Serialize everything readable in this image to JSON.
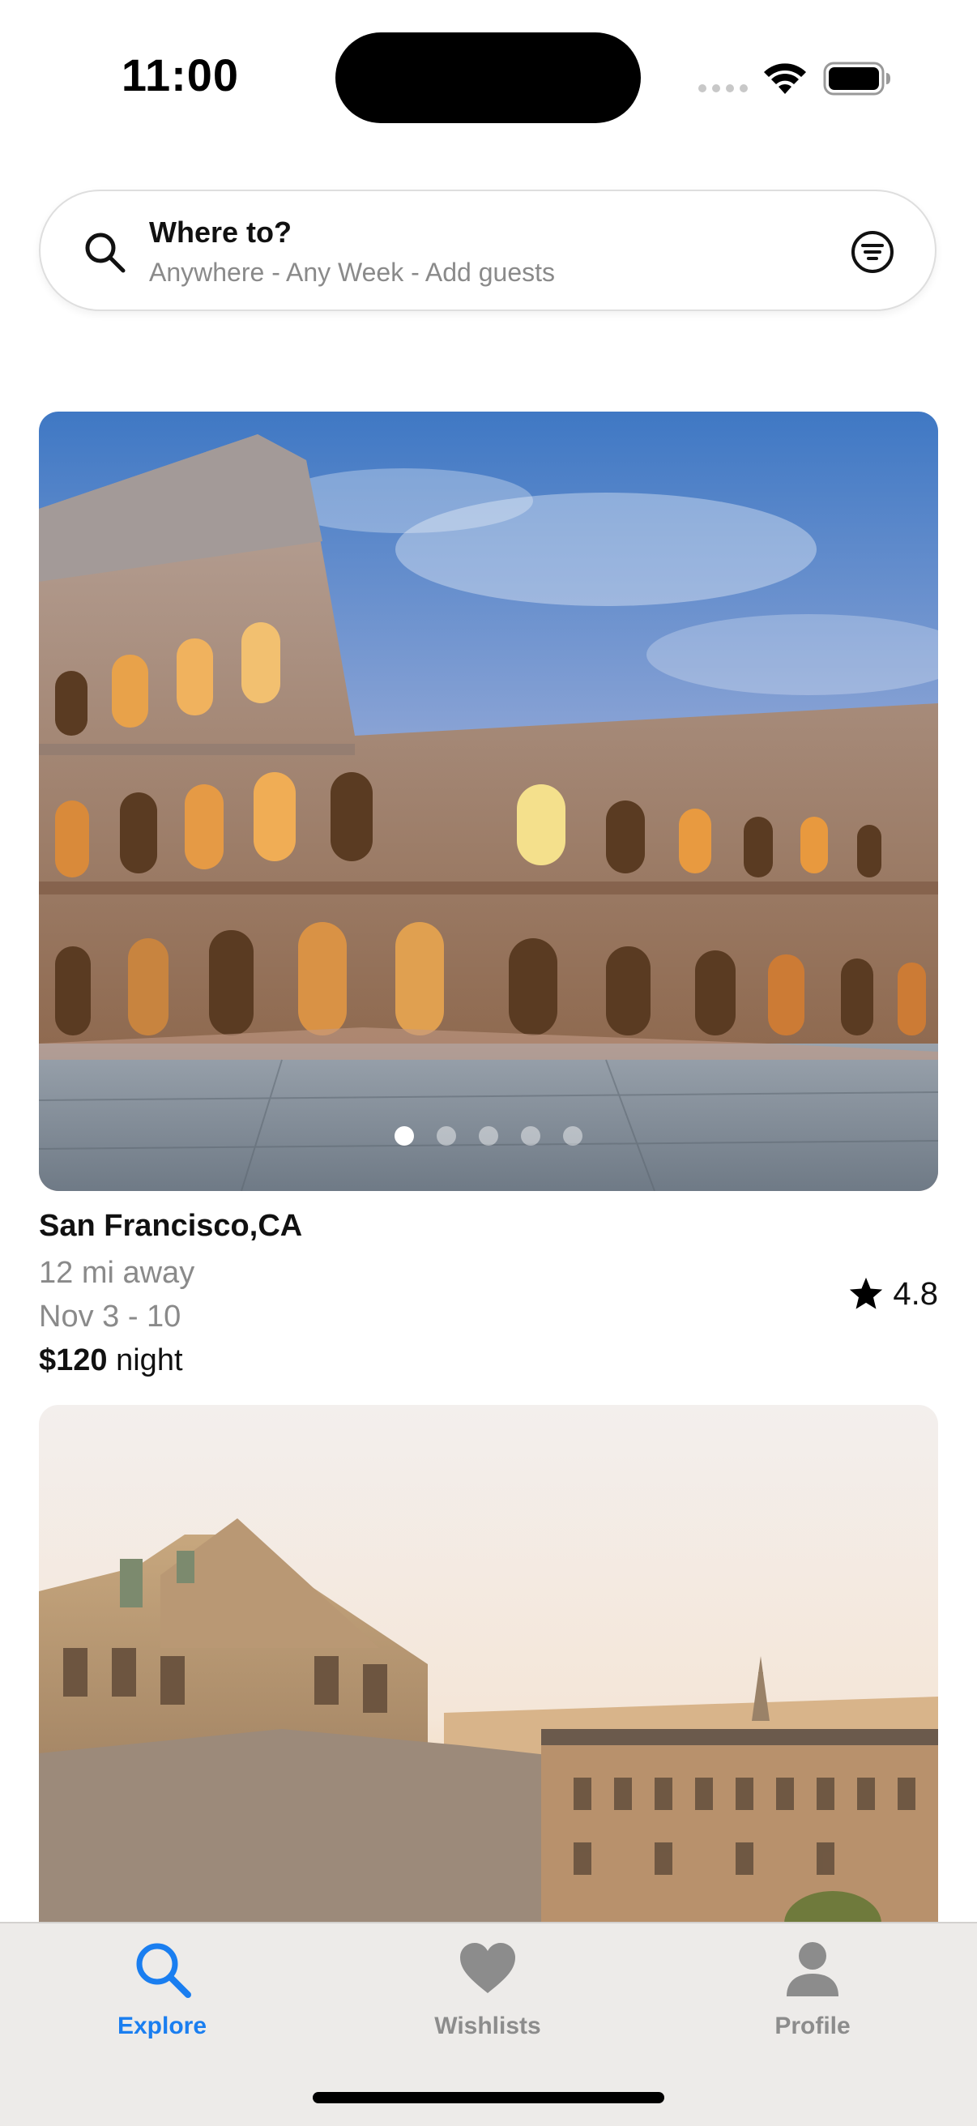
{
  "status_bar": {
    "time": "11:00",
    "icons": [
      "cellular-signal-icon",
      "wifi-icon",
      "battery-icon"
    ]
  },
  "search": {
    "title": "Where to?",
    "subtitle": "Anywhere - Any Week - Add guests",
    "icons": [
      "search-icon",
      "filter-icon"
    ]
  },
  "listings": [
    {
      "photo": "colosseum-photo",
      "city": "San Francisco,CA",
      "distance": "12 mi away",
      "dates": "Nov 3 - 10",
      "price": "$120",
      "price_unit": "night",
      "rating": "4.8",
      "image_count": 5,
      "active_image_index": 0
    },
    {
      "photo": "paris-rooftops-photo"
    }
  ],
  "tabs": [
    {
      "label": "Explore",
      "icon": "search-icon",
      "active": true
    },
    {
      "label": "Wishlists",
      "icon": "heart-icon",
      "active": false
    },
    {
      "label": "Profile",
      "icon": "person-icon",
      "active": false
    }
  ],
  "colors": {
    "accent": "#1a7ef0",
    "inactive_tab": "#8c8c8c",
    "secondary_text": "#8a8a8a"
  }
}
